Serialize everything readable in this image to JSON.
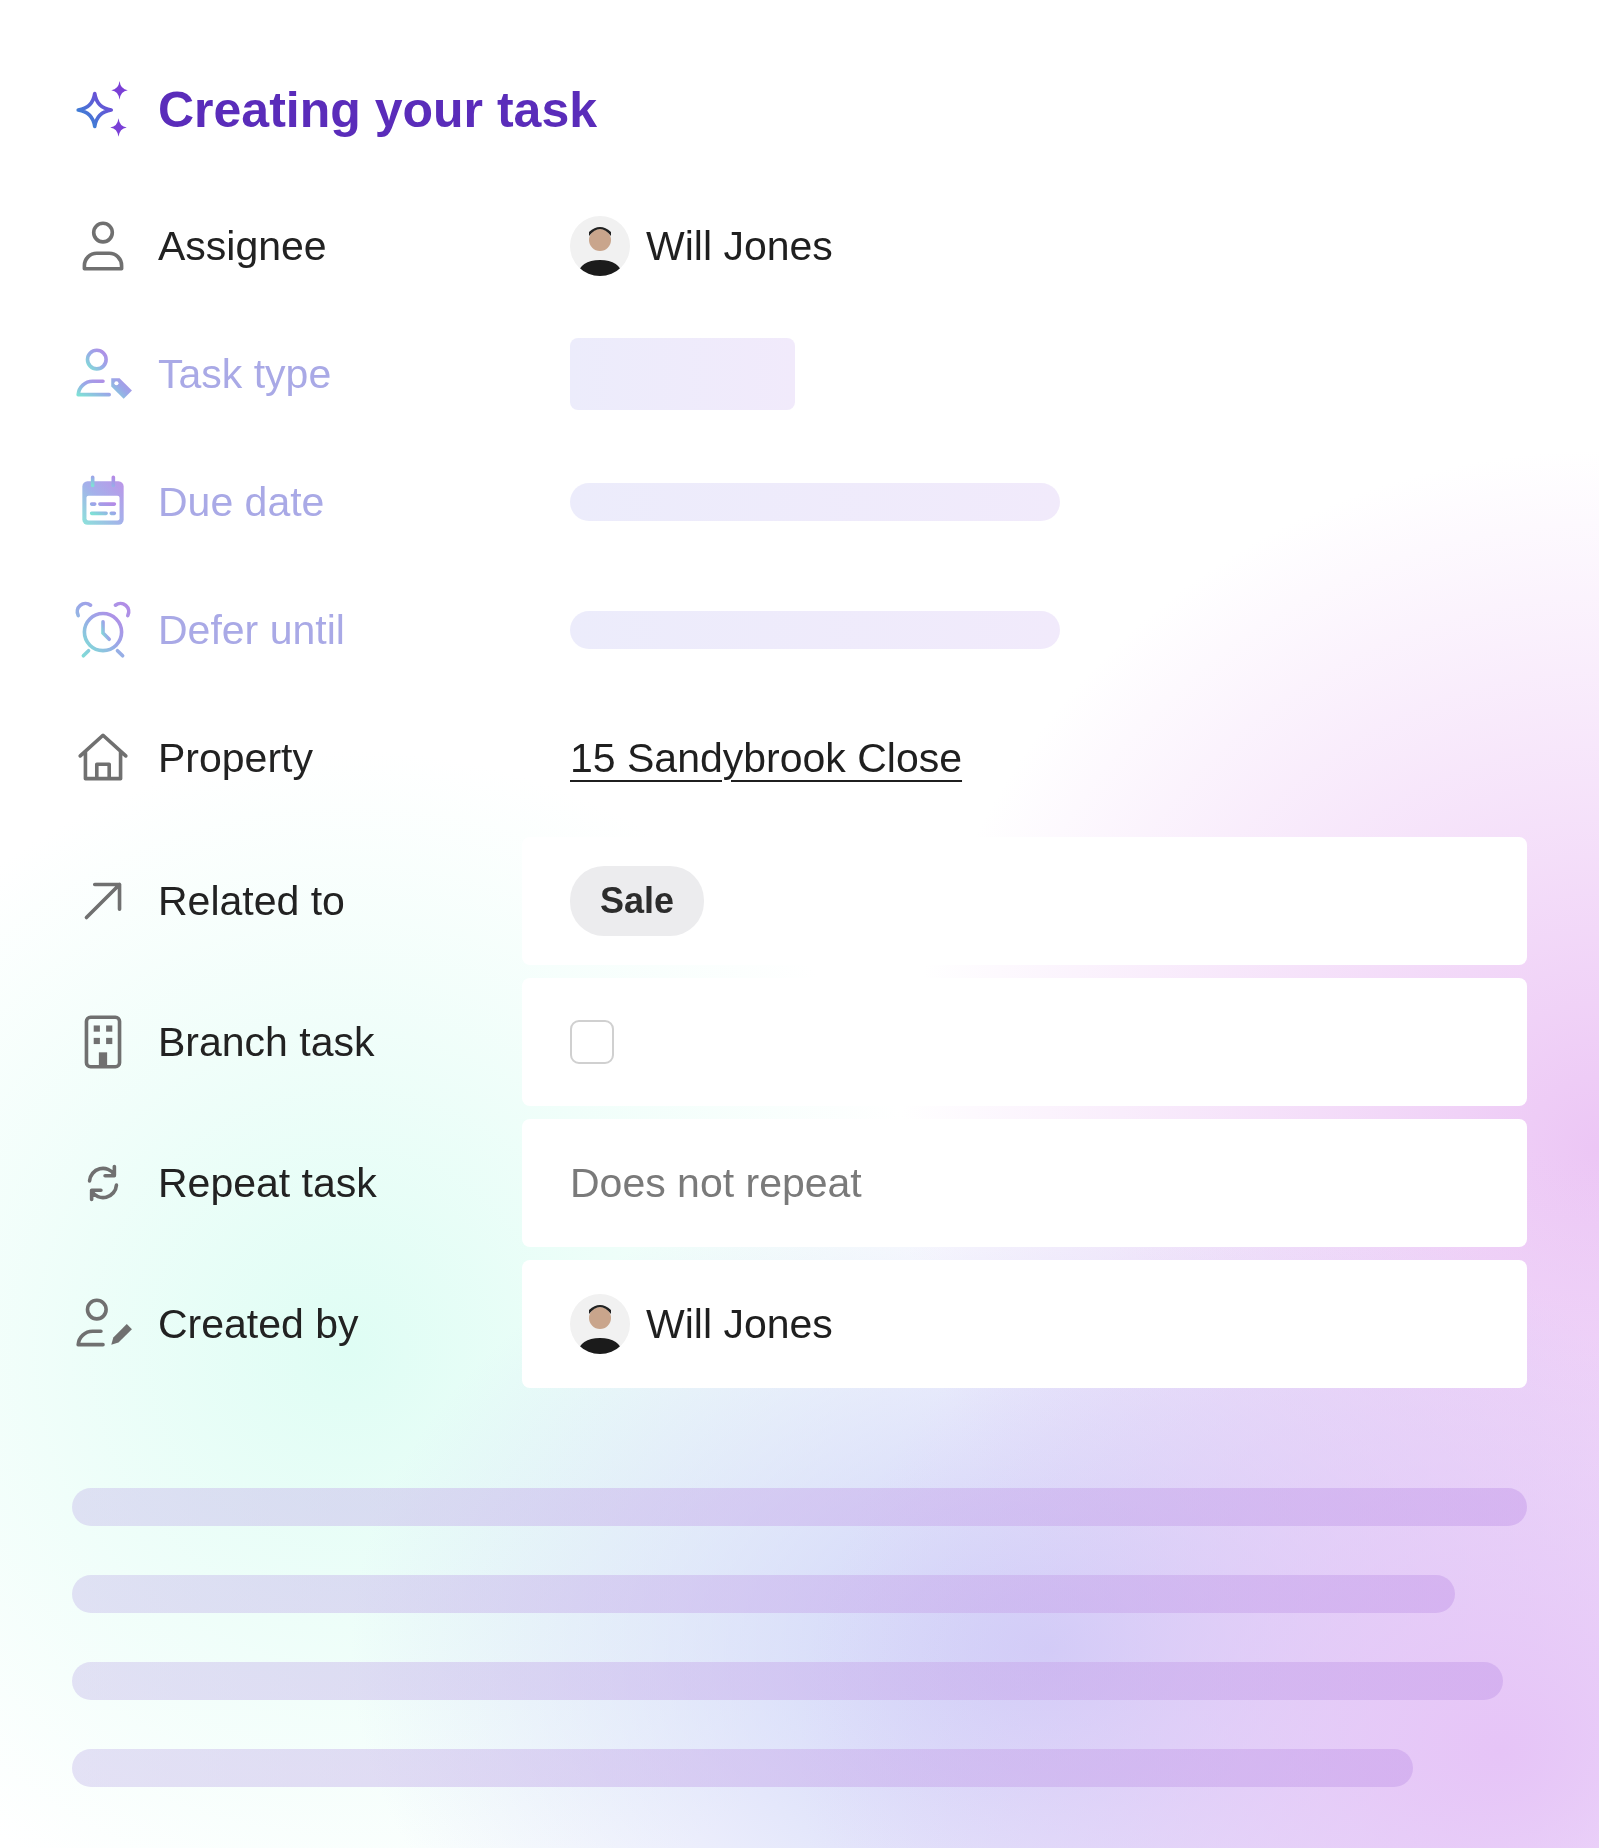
{
  "title": "Creating your task",
  "fields": [
    {
      "label": "Assignee",
      "faded": false,
      "kind": "person",
      "value": "Will Jones"
    },
    {
      "label": "Task type",
      "faded": true,
      "kind": "skeleton-block"
    },
    {
      "label": "Due date",
      "faded": true,
      "kind": "skeleton-line"
    },
    {
      "label": "Defer until",
      "faded": true,
      "kind": "skeleton-line"
    },
    {
      "label": "Property",
      "faded": false,
      "kind": "link",
      "value": "15 Sandybrook Close"
    },
    {
      "label": "Related to",
      "faded": false,
      "kind": "tag",
      "value": "Sale"
    },
    {
      "label": "Branch task",
      "faded": false,
      "kind": "checkbox",
      "checked": false
    },
    {
      "label": "Repeat task",
      "faded": false,
      "kind": "text",
      "placeholder": "Does not repeat"
    },
    {
      "label": "Created by",
      "faded": false,
      "kind": "person",
      "value": "Will Jones"
    }
  ]
}
